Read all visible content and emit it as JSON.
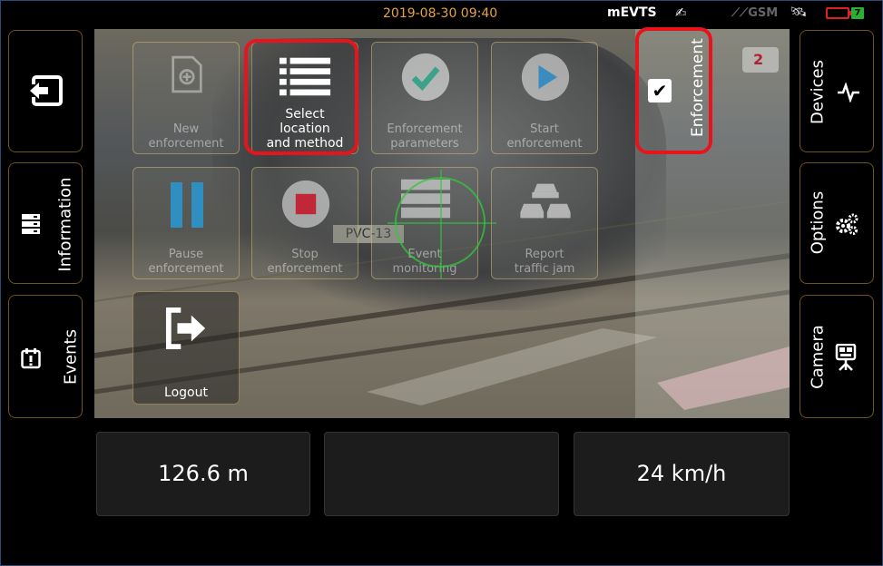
{
  "status_bar": {
    "datetime": "2019-08-30 09:40",
    "app_name": "mEVTS",
    "gsm_label": "GSM",
    "charge_label": "7"
  },
  "left_nav": {
    "back_icon": "back-arrow-icon",
    "information_label": "Information",
    "events_label": "Events"
  },
  "right_nav": {
    "devices_label": "Devices",
    "options_label": "Options",
    "camera_label": "Camera"
  },
  "menu": {
    "new_enforcement": [
      "New",
      "enforcement"
    ],
    "select_location": [
      "Select",
      "location",
      "and method"
    ],
    "enforcement_parameters": [
      "Enforcement",
      "parameters"
    ],
    "start_enforcement": [
      "Start",
      "enforcement"
    ],
    "pause_enforcement": [
      "Pause",
      "enforcement"
    ],
    "stop_enforcement": [
      "Stop",
      "enforcement"
    ],
    "event_monitoring": [
      "Event",
      "monitoring"
    ],
    "report_traffic_jam": [
      "Report",
      "traffic jam"
    ],
    "logout": "Logout"
  },
  "enforcement_toggle": {
    "label": "Enforcement",
    "checked": true
  },
  "camera_view": {
    "plate_text": "PVC-13",
    "camera_badge": "2"
  },
  "readouts": {
    "distance": "126.6 m",
    "middle": "",
    "speed": "24 km/h"
  },
  "colors": {
    "highlight": "#e8141b",
    "accent_orange": "#e8a33d",
    "button_border": "#6e5418"
  }
}
